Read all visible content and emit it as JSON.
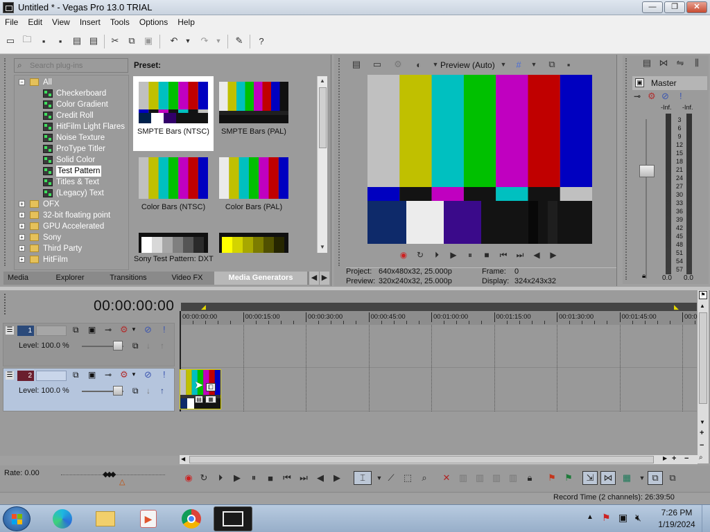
{
  "window": {
    "title": "Untitled * - Vegas Pro 13.0 TRIAL",
    "minimize_label": "—",
    "maximize_label": "❐",
    "close_label": "✕"
  },
  "menu": [
    "File",
    "Edit",
    "View",
    "Insert",
    "Tools",
    "Options",
    "Help"
  ],
  "explorer": {
    "search_placeholder": "Search plug-ins",
    "tree": [
      {
        "label": "All",
        "type": "folder",
        "level": 0,
        "expanded": true
      },
      {
        "label": "Checkerboard",
        "type": "plugin",
        "level": 1
      },
      {
        "label": "Color Gradient",
        "type": "plugin",
        "level": 1
      },
      {
        "label": "Credit Roll",
        "type": "plugin",
        "level": 1
      },
      {
        "label": "HitFilm Light Flares",
        "type": "plugin",
        "level": 1
      },
      {
        "label": "Noise Texture",
        "type": "plugin",
        "level": 1
      },
      {
        "label": "ProType Titler",
        "type": "plugin",
        "level": 1
      },
      {
        "label": "Solid Color",
        "type": "plugin",
        "level": 1
      },
      {
        "label": "Test Pattern",
        "type": "plugin",
        "level": 1,
        "selected": true
      },
      {
        "label": "Titles & Text",
        "type": "plugin",
        "level": 1
      },
      {
        "label": "(Legacy) Text",
        "type": "plugin",
        "level": 1
      },
      {
        "label": "OFX",
        "type": "folder",
        "level": 0
      },
      {
        "label": "32-bit floating point",
        "type": "folder",
        "level": 0
      },
      {
        "label": "GPU Accelerated",
        "type": "folder",
        "level": 0
      },
      {
        "label": "Sony",
        "type": "folder",
        "level": 0
      },
      {
        "label": "Third Party",
        "type": "folder",
        "level": 0
      },
      {
        "label": "HitFilm",
        "type": "folder",
        "level": 0
      }
    ]
  },
  "presets": {
    "label": "Preset:",
    "items": [
      {
        "caption": "SMPTE Bars (NTSC)",
        "selected": true
      },
      {
        "caption": "SMPTE Bars (PAL)"
      },
      {
        "caption": "Color Bars (NTSC)"
      },
      {
        "caption": "Color Bars (PAL)"
      },
      {
        "caption": ""
      },
      {
        "caption": ""
      }
    ],
    "status": "Sony Test Pattern: DXT"
  },
  "tabs": [
    "Media",
    "Explorer",
    "Transitions",
    "Video FX",
    "Media Generators"
  ],
  "active_tab": "Media Generators",
  "preview": {
    "mode_label": "Preview (Auto)",
    "project_label": "Project:",
    "project_value": "640x480x32, 25.000p",
    "preview_label": "Preview:",
    "preview_value": "320x240x32, 25.000p",
    "frame_label": "Frame:",
    "frame_value": "0",
    "display_label": "Display:",
    "display_value": "324x243x32"
  },
  "mixer": {
    "title": "Master",
    "left_peak": "-Inf.",
    "right_peak": "-Inf.",
    "scale": [
      "3",
      "6",
      "9",
      "12",
      "15",
      "18",
      "21",
      "24",
      "27",
      "30",
      "33",
      "36",
      "39",
      "42",
      "45",
      "48",
      "51",
      "54",
      "57"
    ],
    "left_value": "0.0",
    "right_value": "0.0"
  },
  "timeline": {
    "timecode": "00:00:00:00",
    "ruler": [
      "00:00:00:00",
      "00:00:15:00",
      "00:00:30:00",
      "00:00:45:00",
      "00:01:00:00",
      "00:01:15:00",
      "00:01:30:00",
      "00:01:45:00",
      "00:0"
    ],
    "tracks": [
      {
        "number": "1",
        "level": "Level: 100.0 %",
        "selected": false
      },
      {
        "number": "2",
        "level": "Level: 100.0 %",
        "selected": true
      }
    ],
    "rate": "Rate: 0.00",
    "record_time": "Record Time (2 channels): 26:39:50"
  },
  "taskbar": {
    "time": "7:26 PM",
    "date": "1/19/2024"
  },
  "colors": {
    "panel_gray": "#9b9b9b",
    "selected_track": "#b5c5dd",
    "taskbar": "#a9bdd3"
  }
}
